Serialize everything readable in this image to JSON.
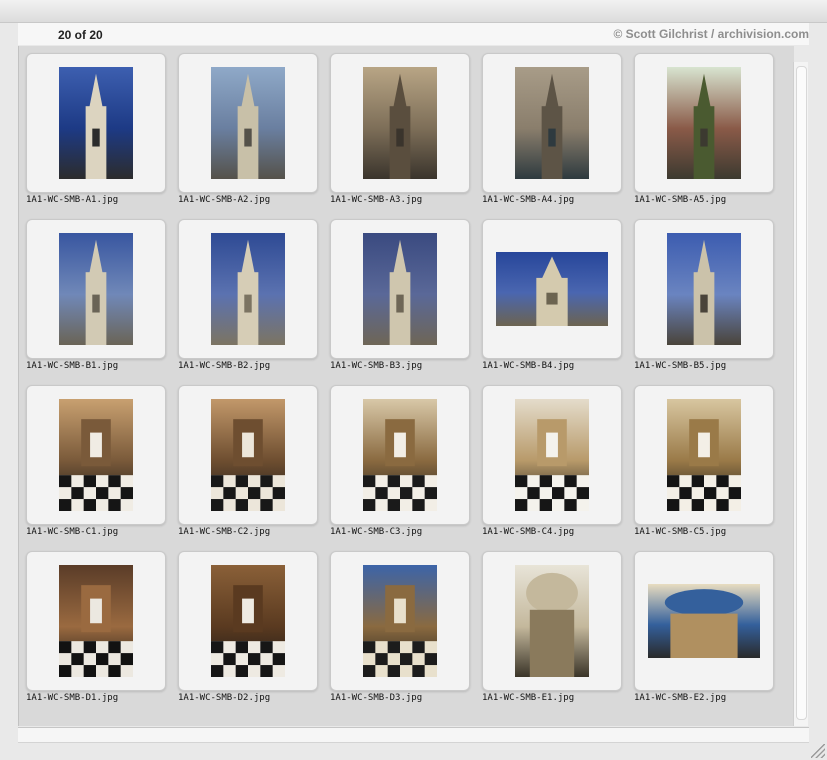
{
  "header": {
    "count_label": "20 of 20",
    "credit": "© Scott Gilchrist / archivision.com"
  },
  "items": [
    {
      "label": "1A1-WC-SMB-A1.jpg",
      "subject": "street view church spire",
      "orientation": "portrait",
      "palette": [
        "#3d5fb0",
        "#1d3a85",
        "#dcd4c0",
        "#2c2c2c"
      ]
    },
    {
      "label": "1A1-WC-SMB-A2.jpg",
      "subject": "church tower base",
      "orientation": "portrait",
      "palette": [
        "#8fa9c8",
        "#6a7fa0",
        "#c8c0a8",
        "#55524a"
      ]
    },
    {
      "label": "1A1-WC-SMB-A3.jpg",
      "subject": "church doorway street",
      "orientation": "portrait",
      "palette": [
        "#b8a585",
        "#7d6e58",
        "#5a4e3e",
        "#3a342c"
      ]
    },
    {
      "label": "1A1-WC-SMB-A4.jpg",
      "subject": "stone doorway",
      "orientation": "portrait",
      "palette": [
        "#a89c88",
        "#8a7e6c",
        "#5d5446",
        "#2e3a3f"
      ]
    },
    {
      "label": "1A1-WC-SMB-A5.jpg",
      "subject": "churchyard garden",
      "orientation": "portrait",
      "palette": [
        "#d8e4d0",
        "#8a5a48",
        "#4a5a30",
        "#3c3a30"
      ]
    },
    {
      "label": "1A1-WC-SMB-B1.jpg",
      "subject": "steeple against sky",
      "orientation": "portrait",
      "palette": [
        "#3856a0",
        "#7088b8",
        "#d2cab4",
        "#6a6456"
      ]
    },
    {
      "label": "1A1-WC-SMB-B2.jpg",
      "subject": "steeple columns",
      "orientation": "portrait",
      "palette": [
        "#2e4a94",
        "#5b72b0",
        "#d6cdb6",
        "#7c7462"
      ]
    },
    {
      "label": "1A1-WC-SMB-B3.jpg",
      "subject": "steeple spire",
      "orientation": "portrait",
      "palette": [
        "#3a4a80",
        "#5a6898",
        "#cfc6ae",
        "#6e6656"
      ]
    },
    {
      "label": "1A1-WC-SMB-B4.jpg",
      "subject": "steeple landscape",
      "orientation": "landscape",
      "palette": [
        "#27469a",
        "#4a66b0",
        "#d4caae",
        "#6c6450"
      ]
    },
    {
      "label": "1A1-WC-SMB-B5.jpg",
      "subject": "tower detail",
      "orientation": "portrait",
      "palette": [
        "#3c5cb0",
        "#6a84c0",
        "#cbc2aa",
        "#4a443a"
      ]
    },
    {
      "label": "1A1-WC-SMB-C1.jpg",
      "subject": "church interior nave",
      "orientation": "portrait",
      "palette": [
        "#c8a070",
        "#7a5a3a",
        "#f0ece4",
        "#151515"
      ]
    },
    {
      "label": "1A1-WC-SMB-C2.jpg",
      "subject": "church interior altar",
      "orientation": "portrait",
      "palette": [
        "#c2986a",
        "#6e4e30",
        "#ece6da",
        "#181818"
      ]
    },
    {
      "label": "1A1-WC-SMB-C3.jpg",
      "subject": "organ gallery",
      "orientation": "portrait",
      "palette": [
        "#d8c8a8",
        "#8a6a40",
        "#f2eee6",
        "#1a1a1a"
      ]
    },
    {
      "label": "1A1-WC-SMB-C4.jpg",
      "subject": "nave checkered floor",
      "orientation": "portrait",
      "palette": [
        "#e4dccb",
        "#b89a6a",
        "#f4f2ec",
        "#161616"
      ]
    },
    {
      "label": "1A1-WC-SMB-C5.jpg",
      "subject": "side aisle",
      "orientation": "portrait",
      "palette": [
        "#d8c6a0",
        "#9a7a48",
        "#f3efe6",
        "#141414"
      ]
    },
    {
      "label": "1A1-WC-SMB-D1.jpg",
      "subject": "altar view",
      "orientation": "portrait",
      "palette": [
        "#5a3c28",
        "#9a6a40",
        "#ece8e0",
        "#121212"
      ]
    },
    {
      "label": "1A1-WC-SMB-D2.jpg",
      "subject": "pulpit woodwork",
      "orientation": "portrait",
      "palette": [
        "#8a6038",
        "#5a3a20",
        "#eeeae2",
        "#161616"
      ]
    },
    {
      "label": "1A1-WC-SMB-D3.jpg",
      "subject": "organ case",
      "orientation": "portrait",
      "palette": [
        "#3c64a8",
        "#8a6a40",
        "#e8e0cc",
        "#1c1c1c"
      ]
    },
    {
      "label": "1A1-WC-SMB-E1.jpg",
      "subject": "interior arch",
      "orientation": "portrait",
      "palette": [
        "#e8e4d8",
        "#c4b89c",
        "#8a7a5c",
        "#3a3428"
      ]
    },
    {
      "label": "1A1-WC-SMB-E2.jpg",
      "subject": "ceiling dome",
      "orientation": "landscape",
      "palette": [
        "#e8dcc0",
        "#34609c",
        "#b09060",
        "#2a2a2a"
      ]
    }
  ]
}
